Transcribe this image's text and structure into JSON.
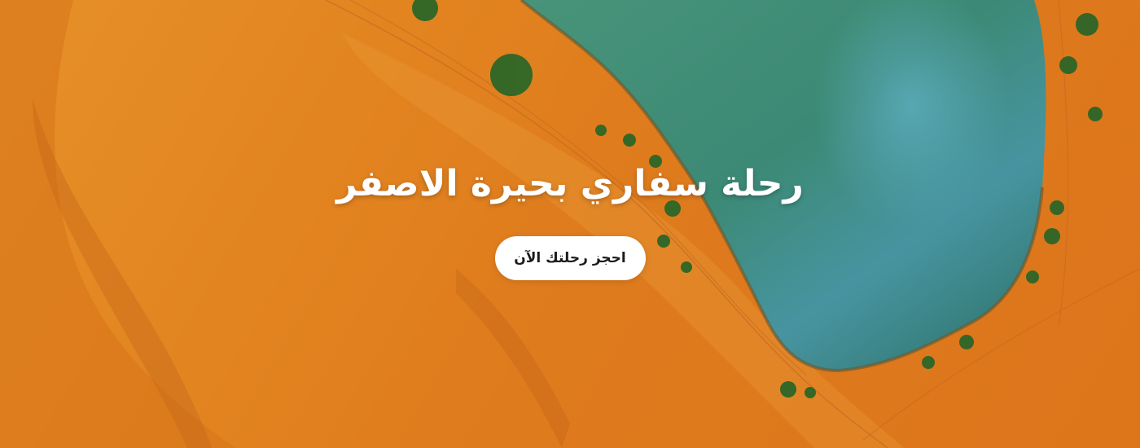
{
  "hero": {
    "title": "رحلة سفاري بحيرة الاصفر",
    "cta_label": "احجز رحلتك الآن"
  },
  "colors": {
    "sand": "#ec8a22",
    "sand_shadow": "#c9651a",
    "lake": "#3f8f7a",
    "lake_deep": "#2d6f66",
    "lake_highlight": "#57a9b3",
    "shrub": "#2f6b2a",
    "button_bg": "#ffffff",
    "title_text": "#ffffff"
  }
}
